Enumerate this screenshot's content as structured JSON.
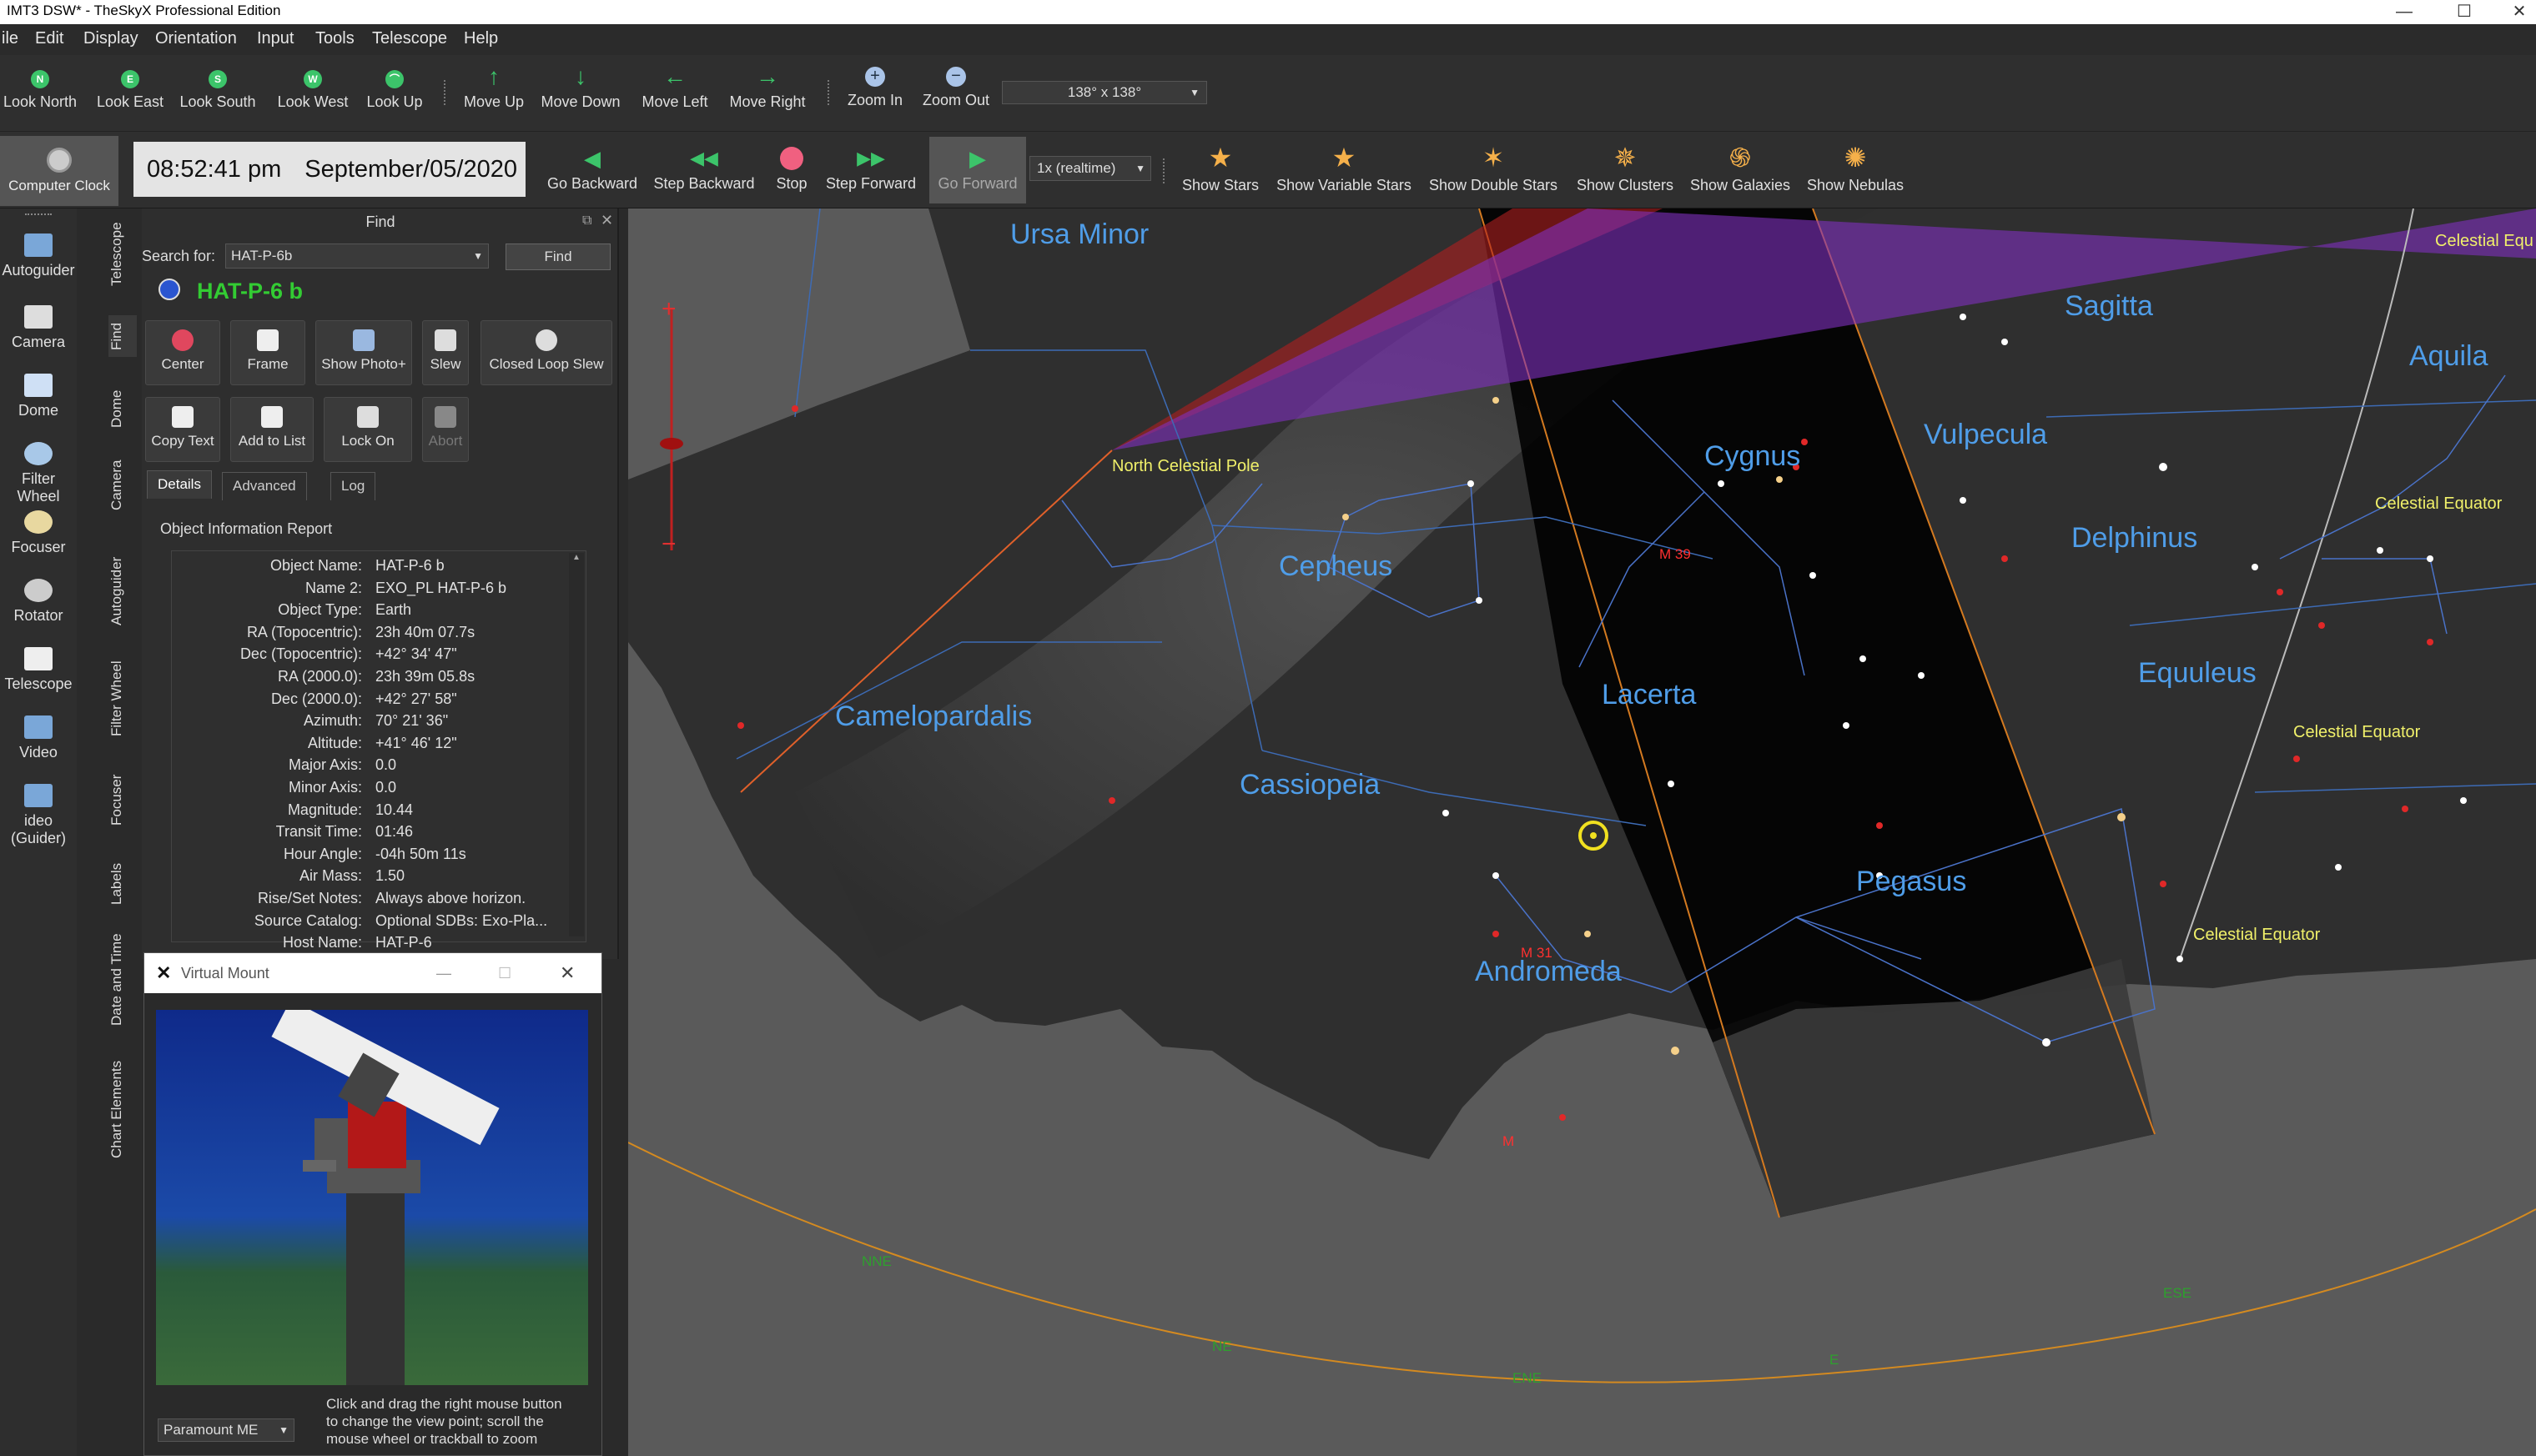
{
  "window": {
    "title": "IMT3 DSW* - TheSkyX Professional Edition"
  },
  "menu": [
    "ile",
    "Edit",
    "Display",
    "Orientation",
    "Input",
    "Tools",
    "Telescope",
    "Help"
  ],
  "toolbar1": {
    "look_north": "Look North",
    "look_east": "Look East",
    "look_south": "Look South",
    "look_west": "Look West",
    "look_up": "Look Up",
    "move_up": "Move Up",
    "move_down": "Move Down",
    "move_left": "Move Left",
    "move_right": "Move Right",
    "zoom_in": "Zoom In",
    "zoom_out": "Zoom Out",
    "fov": "138° x 138°"
  },
  "toolbar2": {
    "computer_clock": "Computer Clock",
    "time": "08:52:41 pm",
    "date": "September/05/2020",
    "go_backward": "Go Backward",
    "step_backward": "Step Backward",
    "stop": "Stop",
    "step_forward": "Step Forward",
    "go_forward": "Go Forward",
    "rate": "1x (realtime)",
    "show_stars": "Show Stars",
    "show_variable_stars": "Show Variable Stars",
    "show_double_stars": "Show Double Stars",
    "show_clusters": "Show Clusters",
    "show_galaxies": "Show Galaxies",
    "show_nebulas": "Show Nebulas"
  },
  "left_icons": [
    "Autoguider",
    "Camera",
    "Dome",
    "Filter Wheel",
    "Focuser",
    "Rotator",
    "Telescope",
    "Video",
    "ideo (Guider)"
  ],
  "vertical_tabs": [
    "Telescope",
    "Find",
    "Dome",
    "Camera",
    "Autoguider",
    "Filter Wheel",
    "Focuser",
    "Labels",
    "Date and Time",
    "Chart Elements"
  ],
  "find": {
    "header": "Find",
    "search_label": "Search for:",
    "search_value": "HAT-P-6b",
    "find_button": "Find",
    "object_title": "HAT-P-6 b",
    "buttons": [
      "Center",
      "Frame",
      "Show Photo+",
      "Slew",
      "Closed Loop Slew",
      "Copy Text",
      "Add to List",
      "Lock On",
      "Abort"
    ],
    "tabs": [
      "Details",
      "Advanced",
      "Log"
    ],
    "report_title": "Object Information Report",
    "rows": [
      {
        "k": "Object Name:",
        "v": "HAT-P-6 b"
      },
      {
        "k": "Name 2:",
        "v": "EXO_PL HAT-P-6 b"
      },
      {
        "k": "Object Type:",
        "v": "Earth"
      },
      {
        "k": "RA (Topocentric):",
        "v": "23h 40m 07.7s"
      },
      {
        "k": "Dec (Topocentric):",
        "v": "+42° 34' 47\""
      },
      {
        "k": "RA (2000.0):",
        "v": "23h 39m 05.8s"
      },
      {
        "k": "Dec (2000.0):",
        "v": "+42° 27' 58\""
      },
      {
        "k": "Azimuth:",
        "v": "70° 21' 36\""
      },
      {
        "k": "Altitude:",
        "v": "+41° 46' 12\""
      },
      {
        "k": "Major Axis:",
        "v": "0.0"
      },
      {
        "k": "Minor Axis:",
        "v": "0.0"
      },
      {
        "k": "Magnitude:",
        "v": "10.44"
      },
      {
        "k": "Transit Time:",
        "v": "01:46"
      },
      {
        "k": "Hour Angle:",
        "v": "-04h 50m 11s"
      },
      {
        "k": "Air Mass:",
        "v": "1.50"
      },
      {
        "k": "Rise/Set Notes:",
        "v": "Always above horizon."
      },
      {
        "k": "Source Catalog:",
        "v": "Optional SDBs: Exo-Pla..."
      },
      {
        "k": "Host Name:",
        "v": "HAT-P-6"
      }
    ]
  },
  "virtual_mount": {
    "title": "Virtual Mount",
    "mount": "Paramount ME",
    "hint": "Click and drag the right mouse button to change the view point; scroll the mouse wheel or trackball to zoom"
  },
  "sky": {
    "constellations": [
      "Ursa Minor",
      "Sagitta",
      "Aquila",
      "Cygnus",
      "Vulpecula",
      "Cepheus",
      "Delphinus",
      "Equuleus",
      "Lacerta",
      "Camelopardalis",
      "Cassiopeia",
      "Pegasus",
      "Andromeda"
    ],
    "labels": {
      "ncp": "North Celestial Pole",
      "ce1": "Celestial Equ",
      "ce2": "Celestial Equator",
      "ce3": "Celestial Equator",
      "ce4": "Celestial Equator",
      "m39": "M 39",
      "m31": "M 31",
      "m": "M"
    },
    "horizon_marks": [
      "NNE",
      "NE",
      "ENE",
      "E",
      "ESE"
    ]
  },
  "colors": {
    "accent": "#4f9de8",
    "find_title": "#33cc33",
    "report_bg": "#2f2f2f"
  }
}
